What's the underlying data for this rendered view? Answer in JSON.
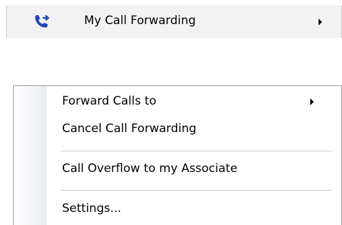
{
  "parent": {
    "label": "My Call Forwarding",
    "icon": "call-forwarding-icon",
    "icon_color": "#1c49b8"
  },
  "submenu": {
    "items": [
      {
        "label": "Forward Calls to",
        "has_submenu": true
      },
      {
        "label": "Cancel Call Forwarding",
        "has_submenu": false
      },
      {
        "label": "Call Overflow to my Associate",
        "has_submenu": false
      },
      {
        "label": "Settings...",
        "has_submenu": false
      }
    ]
  }
}
